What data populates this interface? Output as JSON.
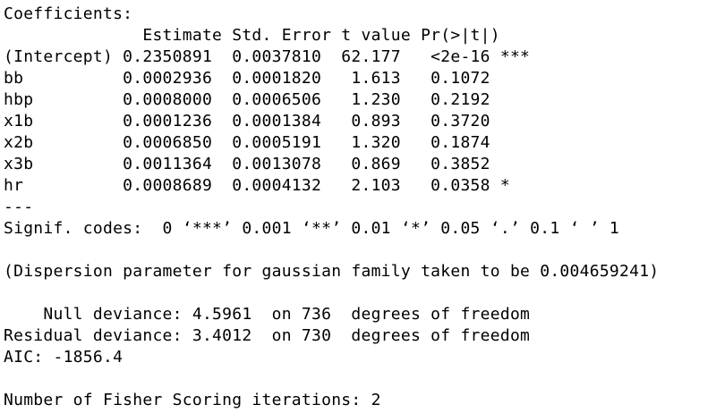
{
  "output": {
    "coef_title": "Coefficients:",
    "coef_header": "              Estimate Std. Error t value Pr(>|t|)    ",
    "rows": [
      "(Intercept) 0.2350891  0.0037810  62.177   <2e-16 ***",
      "bb          0.0002936  0.0001820   1.613   0.1072    ",
      "hbp         0.0008000  0.0006506   1.230   0.2192    ",
      "x1b         0.0001236  0.0001384   0.893   0.3720    ",
      "x2b         0.0006850  0.0005191   1.320   0.1874    ",
      "x3b         0.0011364  0.0013078   0.869   0.3852    ",
      "hr          0.0008689  0.0004132   2.103   0.0358 *  "
    ],
    "separator": "---",
    "signif_codes": "Signif. codes:  0 ‘***’ 0.001 ‘**’ 0.01 ‘*’ 0.05 ‘.’ 0.1 ‘ ’ 1",
    "dispersion": "(Dispersion parameter for gaussian family taken to be 0.004659241)",
    "null_deviance": "    Null deviance: 4.5961  on 736  degrees of freedom",
    "residual_deviance": "Residual deviance: 3.4012  on 730  degrees of freedom",
    "aic": "AIC: -1856.4",
    "fisher_iterations": "Number of Fisher Scoring iterations: 2"
  }
}
